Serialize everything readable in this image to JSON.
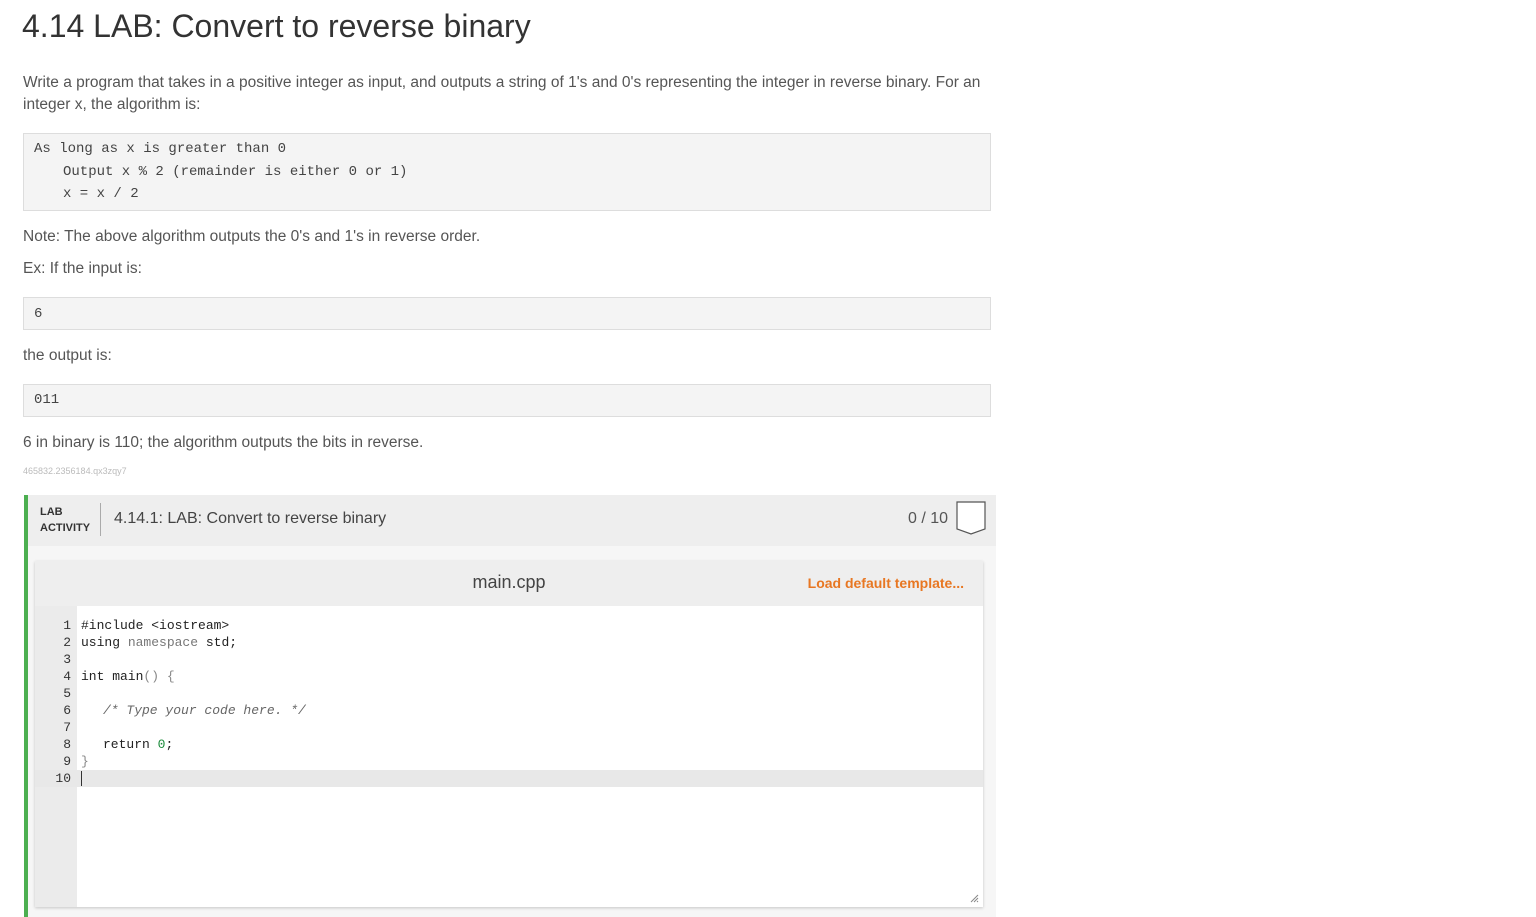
{
  "page": {
    "title": "4.14 LAB: Convert to reverse binary",
    "intro": "Write a program that takes in a positive integer as input, and outputs a string of 1's and 0's representing the integer in reverse binary. For an integer x, the algorithm is:",
    "algorithm": [
      "As long as x is greater than 0",
      "Output x % 2 (remainder is either 0 or 1)",
      "x = x / 2"
    ],
    "note": "Note: The above algorithm outputs the 0's and 1's in reverse order.",
    "ex_label": "Ex: If the input is:",
    "example_input": "6",
    "output_label": "the output is:",
    "example_output": "011",
    "explanation": "6 in binary is 110; the algorithm outputs the bits in reverse.",
    "id_tag": "465832.2356184.qx3zqy7"
  },
  "lab": {
    "tag_line1": "LAB",
    "tag_line2": "ACTIVITY",
    "title": "4.14.1: LAB: Convert to reverse binary",
    "score": "0 / 10",
    "accent_color": "#4caf50"
  },
  "editor": {
    "filename": "main.cpp",
    "load_template": "Load default template...",
    "line_numbers": [
      "1",
      "2",
      "3",
      "4",
      "5",
      "6",
      "7",
      "8",
      "9",
      "10"
    ],
    "code": {
      "l1": "#include <iostream>",
      "l2_kw": "using",
      "l2_ns": "namespace",
      "l2_rest": "std;",
      "l4_a": "int main",
      "l4_b": "() {",
      "l6": "/* Type your code here. */",
      "l8_kw": "return",
      "l8_num": "0",
      "l8_end": ";",
      "l9": "}"
    },
    "link_color": "#e87722"
  }
}
